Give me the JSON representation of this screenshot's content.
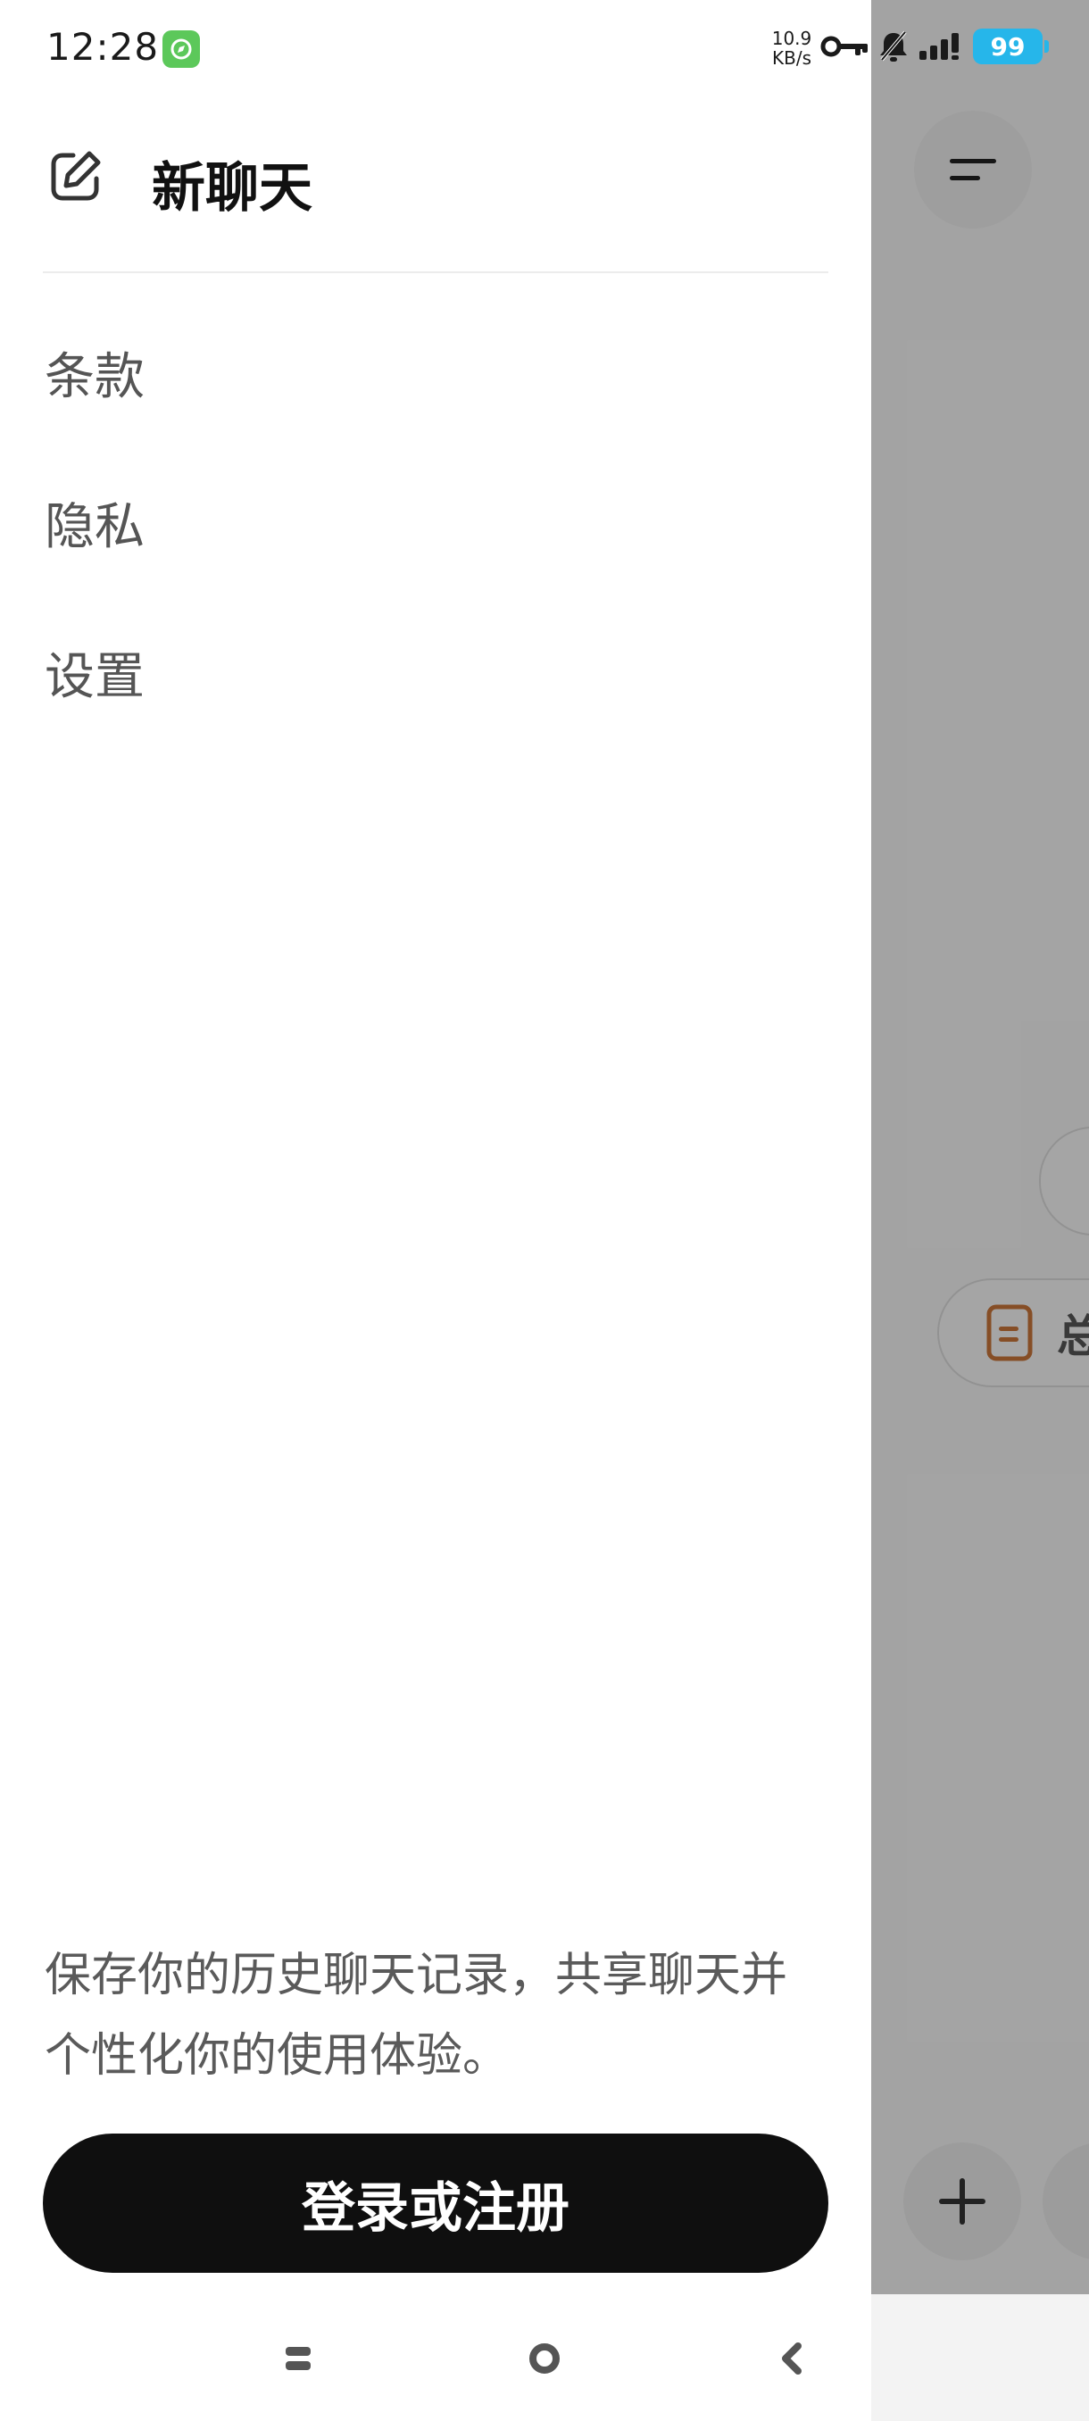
{
  "status_bar": {
    "time": "12:28",
    "net_speed_value": "10.9",
    "net_speed_unit": "KB/s",
    "battery_level": "99",
    "battery_color": "#26b6ea",
    "icons": [
      "app-notification-icon",
      "vpn-key-icon",
      "bell-muted-icon",
      "signal-icon"
    ]
  },
  "drawer": {
    "new_chat_label": "新聊天",
    "menu": {
      "terms": "条款",
      "privacy": "隐私",
      "settings": "设置"
    },
    "promo_text": "保存你的历史聊天记录，共享聊天并个性化你的使用体验。",
    "login_label": "登录或注册"
  },
  "background_app": {
    "chip_label": "总",
    "chip_icon": "document-icon",
    "chip_icon_color": "#c8753a"
  },
  "nav_bar": {
    "buttons": [
      "recents-icon",
      "home-icon",
      "back-icon"
    ]
  }
}
